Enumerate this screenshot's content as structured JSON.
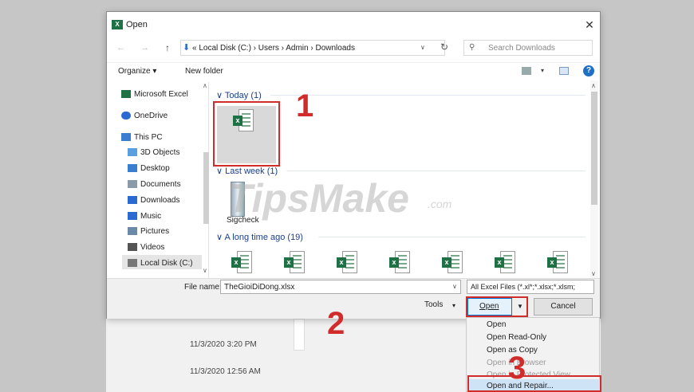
{
  "background": {
    "dates": [
      "11/3/2020 3:20 PM",
      "11/3/2020 12:56 AM"
    ]
  },
  "dialog": {
    "title": "Open",
    "app_badge": "X",
    "close": "✕"
  },
  "address": {
    "crumb": "« Local Disk (C:)  ›  Users  ›  Admin  ›  Downloads",
    "search_placeholder": "Search Downloads"
  },
  "toolbar": {
    "organize": "Organize ▾",
    "new_folder": "New folder",
    "help": "?"
  },
  "nav_pane": {
    "items": [
      {
        "label": "Microsoft Excel",
        "icon": "excel-icon",
        "color": "#1e7145"
      },
      {
        "label": "OneDrive",
        "icon": "cloud-icon",
        "color": "#2a6ad1"
      },
      {
        "label": "This PC",
        "icon": "computer-icon",
        "color": "#3a7fcf"
      },
      {
        "label": "3D Objects",
        "icon": "cube-icon",
        "color": "#5aa0e0"
      },
      {
        "label": "Desktop",
        "icon": "desktop-icon",
        "color": "#3a7fcf"
      },
      {
        "label": "Documents",
        "icon": "document-icon",
        "color": "#8a9aa8"
      },
      {
        "label": "Downloads",
        "icon": "download-icon",
        "color": "#2a6ad1"
      },
      {
        "label": "Music",
        "icon": "music-icon",
        "color": "#2a6ad1"
      },
      {
        "label": "Pictures",
        "icon": "pictures-icon",
        "color": "#6a8aa8"
      },
      {
        "label": "Videos",
        "icon": "video-icon",
        "color": "#555"
      },
      {
        "label": "Local Disk (C:)",
        "icon": "drive-icon",
        "color": "#777"
      }
    ]
  },
  "content": {
    "groups": [
      "Today (1)",
      "Last week (1)",
      "A long time ago (19)"
    ],
    "last_week_file": "Sigcheck",
    "excel_badge": "x",
    "watermark": "TipsMake",
    "watermark_suffix": ".com"
  },
  "annotations": {
    "step1": "1",
    "step2": "2",
    "step3": "3"
  },
  "bottom": {
    "file_name_label": "File name:",
    "file_name_value": "TheGioiDiDong.xlsx",
    "file_type": "All Excel Files (*.xl*;*.xlsx;*.xlsm;",
    "tools": "Tools",
    "open": "Open",
    "cancel": "Cancel"
  },
  "open_menu": {
    "items": [
      {
        "label": "Open",
        "enabled": true
      },
      {
        "label": "Open Read-Only",
        "enabled": true
      },
      {
        "label": "Open as Copy",
        "enabled": true
      },
      {
        "label": "Open in Browser",
        "enabled": false
      },
      {
        "label": "Open in Protected View",
        "enabled": false
      },
      {
        "label": "Open and Repair...",
        "enabled": true
      }
    ]
  },
  "colors": {
    "accent": "#0078d7",
    "annotation": "#d02c2c",
    "excel": "#1e7145"
  }
}
